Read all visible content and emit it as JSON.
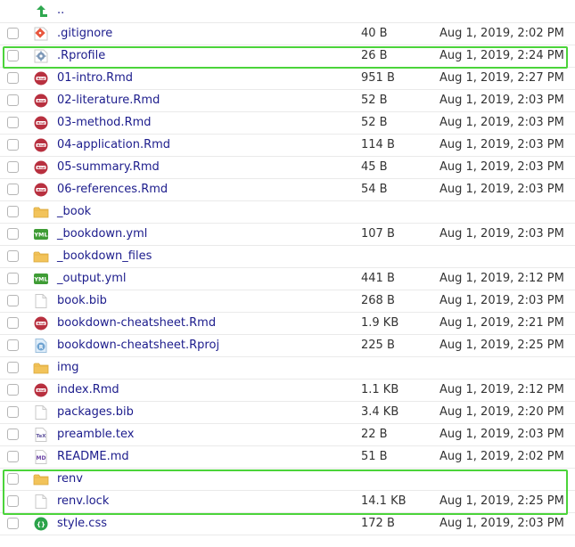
{
  "parent": {
    "label": "..",
    "icon": "up-arrow-icon"
  },
  "files": [
    {
      "name": ".gitignore",
      "size": "40 B",
      "modified": "Aug 1, 2019, 2:02 PM",
      "icon": "git-file-icon"
    },
    {
      "name": ".Rprofile",
      "size": "26 B",
      "modified": "Aug 1, 2019, 2:24 PM",
      "icon": "gear-file-icon"
    },
    {
      "name": "01-intro.Rmd",
      "size": "951 B",
      "modified": "Aug 1, 2019, 2:27 PM",
      "icon": "rmd-file-icon"
    },
    {
      "name": "02-literature.Rmd",
      "size": "52 B",
      "modified": "Aug 1, 2019, 2:03 PM",
      "icon": "rmd-file-icon"
    },
    {
      "name": "03-method.Rmd",
      "size": "52 B",
      "modified": "Aug 1, 2019, 2:03 PM",
      "icon": "rmd-file-icon"
    },
    {
      "name": "04-application.Rmd",
      "size": "114 B",
      "modified": "Aug 1, 2019, 2:03 PM",
      "icon": "rmd-file-icon"
    },
    {
      "name": "05-summary.Rmd",
      "size": "45 B",
      "modified": "Aug 1, 2019, 2:03 PM",
      "icon": "rmd-file-icon"
    },
    {
      "name": "06-references.Rmd",
      "size": "54 B",
      "modified": "Aug 1, 2019, 2:03 PM",
      "icon": "rmd-file-icon"
    },
    {
      "name": "_book",
      "size": "",
      "modified": "",
      "icon": "folder-icon"
    },
    {
      "name": "_bookdown.yml",
      "size": "107 B",
      "modified": "Aug 1, 2019, 2:03 PM",
      "icon": "yml-file-icon"
    },
    {
      "name": "_bookdown_files",
      "size": "",
      "modified": "",
      "icon": "folder-icon"
    },
    {
      "name": "_output.yml",
      "size": "441 B",
      "modified": "Aug 1, 2019, 2:12 PM",
      "icon": "yml-file-icon"
    },
    {
      "name": "book.bib",
      "size": "268 B",
      "modified": "Aug 1, 2019, 2:03 PM",
      "icon": "blank-file-icon"
    },
    {
      "name": "bookdown-cheatsheet.Rmd",
      "size": "1.9 KB",
      "modified": "Aug 1, 2019, 2:21 PM",
      "icon": "rmd-file-icon"
    },
    {
      "name": "bookdown-cheatsheet.Rproj",
      "size": "225 B",
      "modified": "Aug 1, 2019, 2:25 PM",
      "icon": "rproj-file-icon"
    },
    {
      "name": "img",
      "size": "",
      "modified": "",
      "icon": "folder-icon"
    },
    {
      "name": "index.Rmd",
      "size": "1.1 KB",
      "modified": "Aug 1, 2019, 2:12 PM",
      "icon": "rmd-file-icon"
    },
    {
      "name": "packages.bib",
      "size": "3.4 KB",
      "modified": "Aug 1, 2019, 2:20 PM",
      "icon": "blank-file-icon"
    },
    {
      "name": "preamble.tex",
      "size": "22 B",
      "modified": "Aug 1, 2019, 2:03 PM",
      "icon": "tex-file-icon"
    },
    {
      "name": "README.md",
      "size": "51 B",
      "modified": "Aug 1, 2019, 2:02 PM",
      "icon": "md-file-icon"
    },
    {
      "name": "renv",
      "size": "",
      "modified": "",
      "icon": "folder-icon"
    },
    {
      "name": "renv.lock",
      "size": "14.1 KB",
      "modified": "Aug 1, 2019, 2:25 PM",
      "icon": "blank-file-icon"
    },
    {
      "name": "style.css",
      "size": "172 B",
      "modified": "Aug 1, 2019, 2:03 PM",
      "icon": "css-file-icon"
    }
  ],
  "colors": {
    "highlight": "#4bd43a",
    "link": "#1c1c8c"
  }
}
